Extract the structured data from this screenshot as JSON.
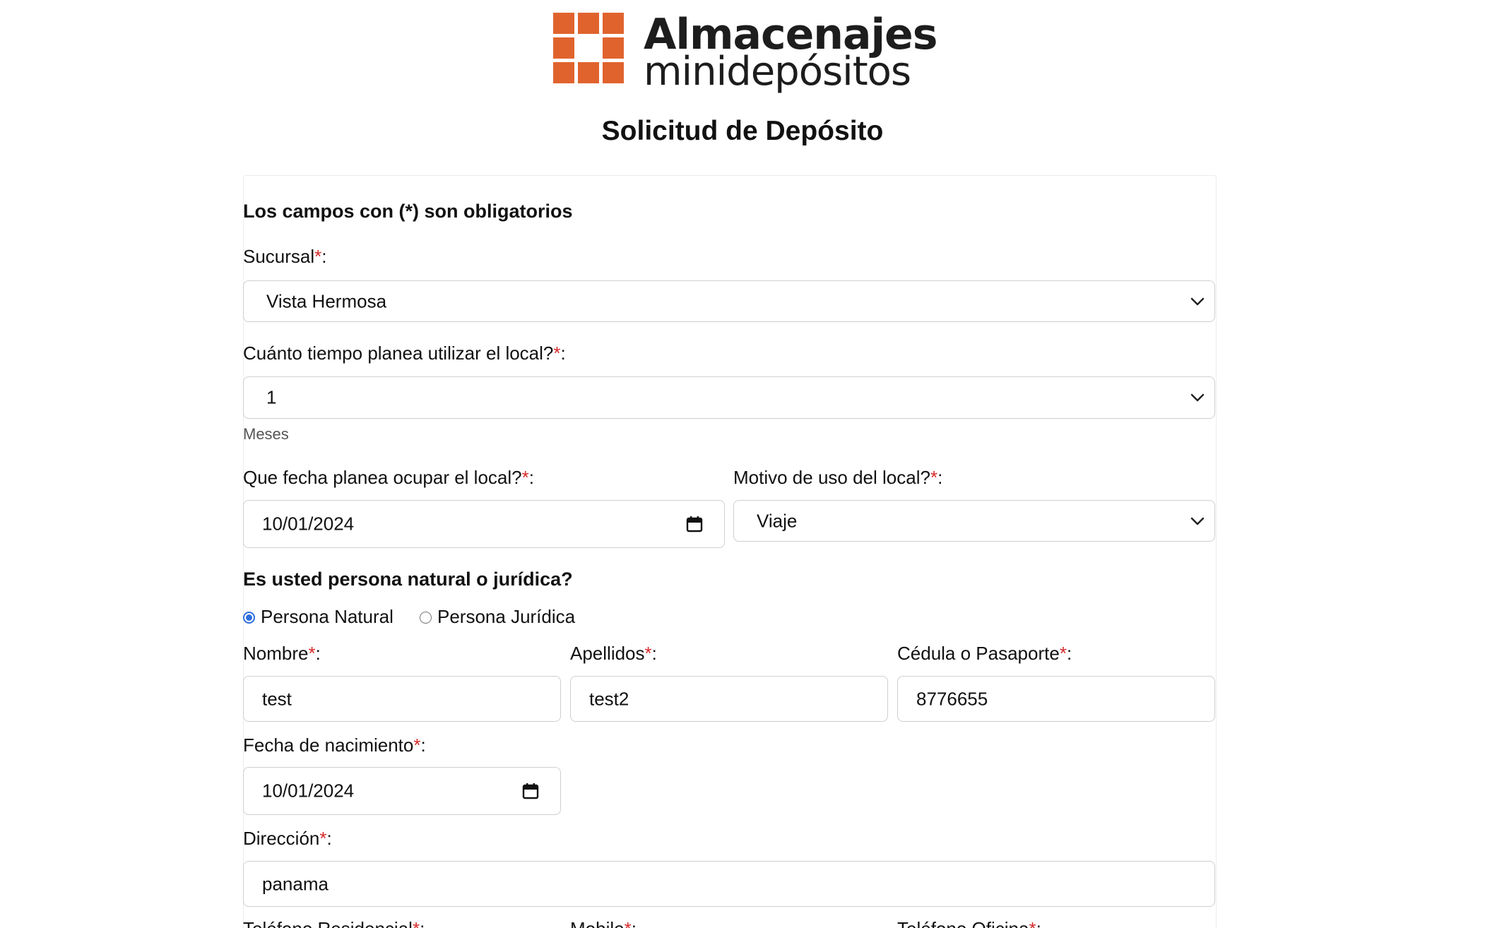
{
  "logo": {
    "line1": "Almacenajes",
    "line2": "minidepósitos",
    "color": "#e0632e"
  },
  "page_title": "Solicitud de Depósito",
  "required_note": "Los campos con (*) son obligatorios",
  "required_mark": "*",
  "colon": ":",
  "sucursal": {
    "label": "Sucursal",
    "value": "Vista Hermosa"
  },
  "tiempo": {
    "label": "Cuánto tiempo planea utilizar el local?",
    "value": "1",
    "help": "Meses"
  },
  "fecha_ocupar": {
    "label": "Que fecha planea ocupar el local?",
    "value": "10/01/2024"
  },
  "motivo": {
    "label": "Motivo de uso del local?",
    "value": "Viaje"
  },
  "persona": {
    "question": "Es usted persona natural o jurídica?",
    "options": [
      {
        "label": "Persona Natural",
        "checked": true
      },
      {
        "label": "Persona Jurídica",
        "checked": false
      }
    ]
  },
  "nombre": {
    "label": "Nombre",
    "value": "test"
  },
  "apellidos": {
    "label": "Apellidos",
    "value": "test2"
  },
  "cedula": {
    "label": "Cédula o Pasaporte",
    "value": "8776655"
  },
  "nacimiento": {
    "label": "Fecha de nacimiento",
    "value": "10/01/2024"
  },
  "direccion": {
    "label": "Dirección",
    "value": "panama"
  },
  "telefonos": {
    "residencial": "Teléfono Residencial",
    "movil": "Mobile",
    "oficina": "Teléfono Oficina"
  },
  "colors": {
    "radio_accent": "#2f6fde",
    "required": "#d62a2a"
  }
}
